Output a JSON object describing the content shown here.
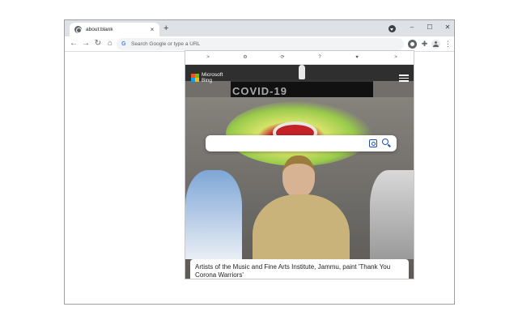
{
  "browser": {
    "tab": {
      "title": "about:blank",
      "close_label": "×"
    },
    "new_tab_label": "+",
    "window_controls": {
      "minimize": "–",
      "maximize": "☐",
      "close": "✕"
    },
    "nav": {
      "back": "←",
      "forward": "→",
      "reload": "↻",
      "home": "⌂"
    },
    "omnibox": {
      "placeholder": "Search Google or type a URL",
      "google_glyph": "G"
    },
    "menu_glyph": "⋮",
    "puzzle_glyph": "✚"
  },
  "popup": {
    "nav": {
      "prev": ">",
      "settings": "⚙",
      "refresh": "⟳",
      "help": "?",
      "heart": "♥",
      "next": ">"
    },
    "logo": {
      "line1": "Microsoft",
      "line2": "Bing"
    },
    "search": {
      "placeholder": ""
    },
    "caption": "Artists of the Music and Fine Arts Institute, Jammu, paint 'Thank You Corona Warriors'",
    "background": {
      "painted_text": "COVID-19"
    }
  },
  "colors": {
    "tabstrip": "#dee1e6",
    "omnibox": "#f1f3f4",
    "accent": "#1a4fbf"
  },
  "icons": [
    "globe-icon",
    "close-icon",
    "plus-icon",
    "profile-icon",
    "back-arrow-icon",
    "forward-arrow-icon",
    "reload-icon",
    "home-icon",
    "google-icon",
    "extension-icon",
    "puzzle-icon",
    "account-icon",
    "menu-icon",
    "settings-icon",
    "refresh-icon",
    "help-icon",
    "heart-icon",
    "chevron-right-icon",
    "hamburger-icon",
    "visual-search-icon",
    "search-icon"
  ]
}
